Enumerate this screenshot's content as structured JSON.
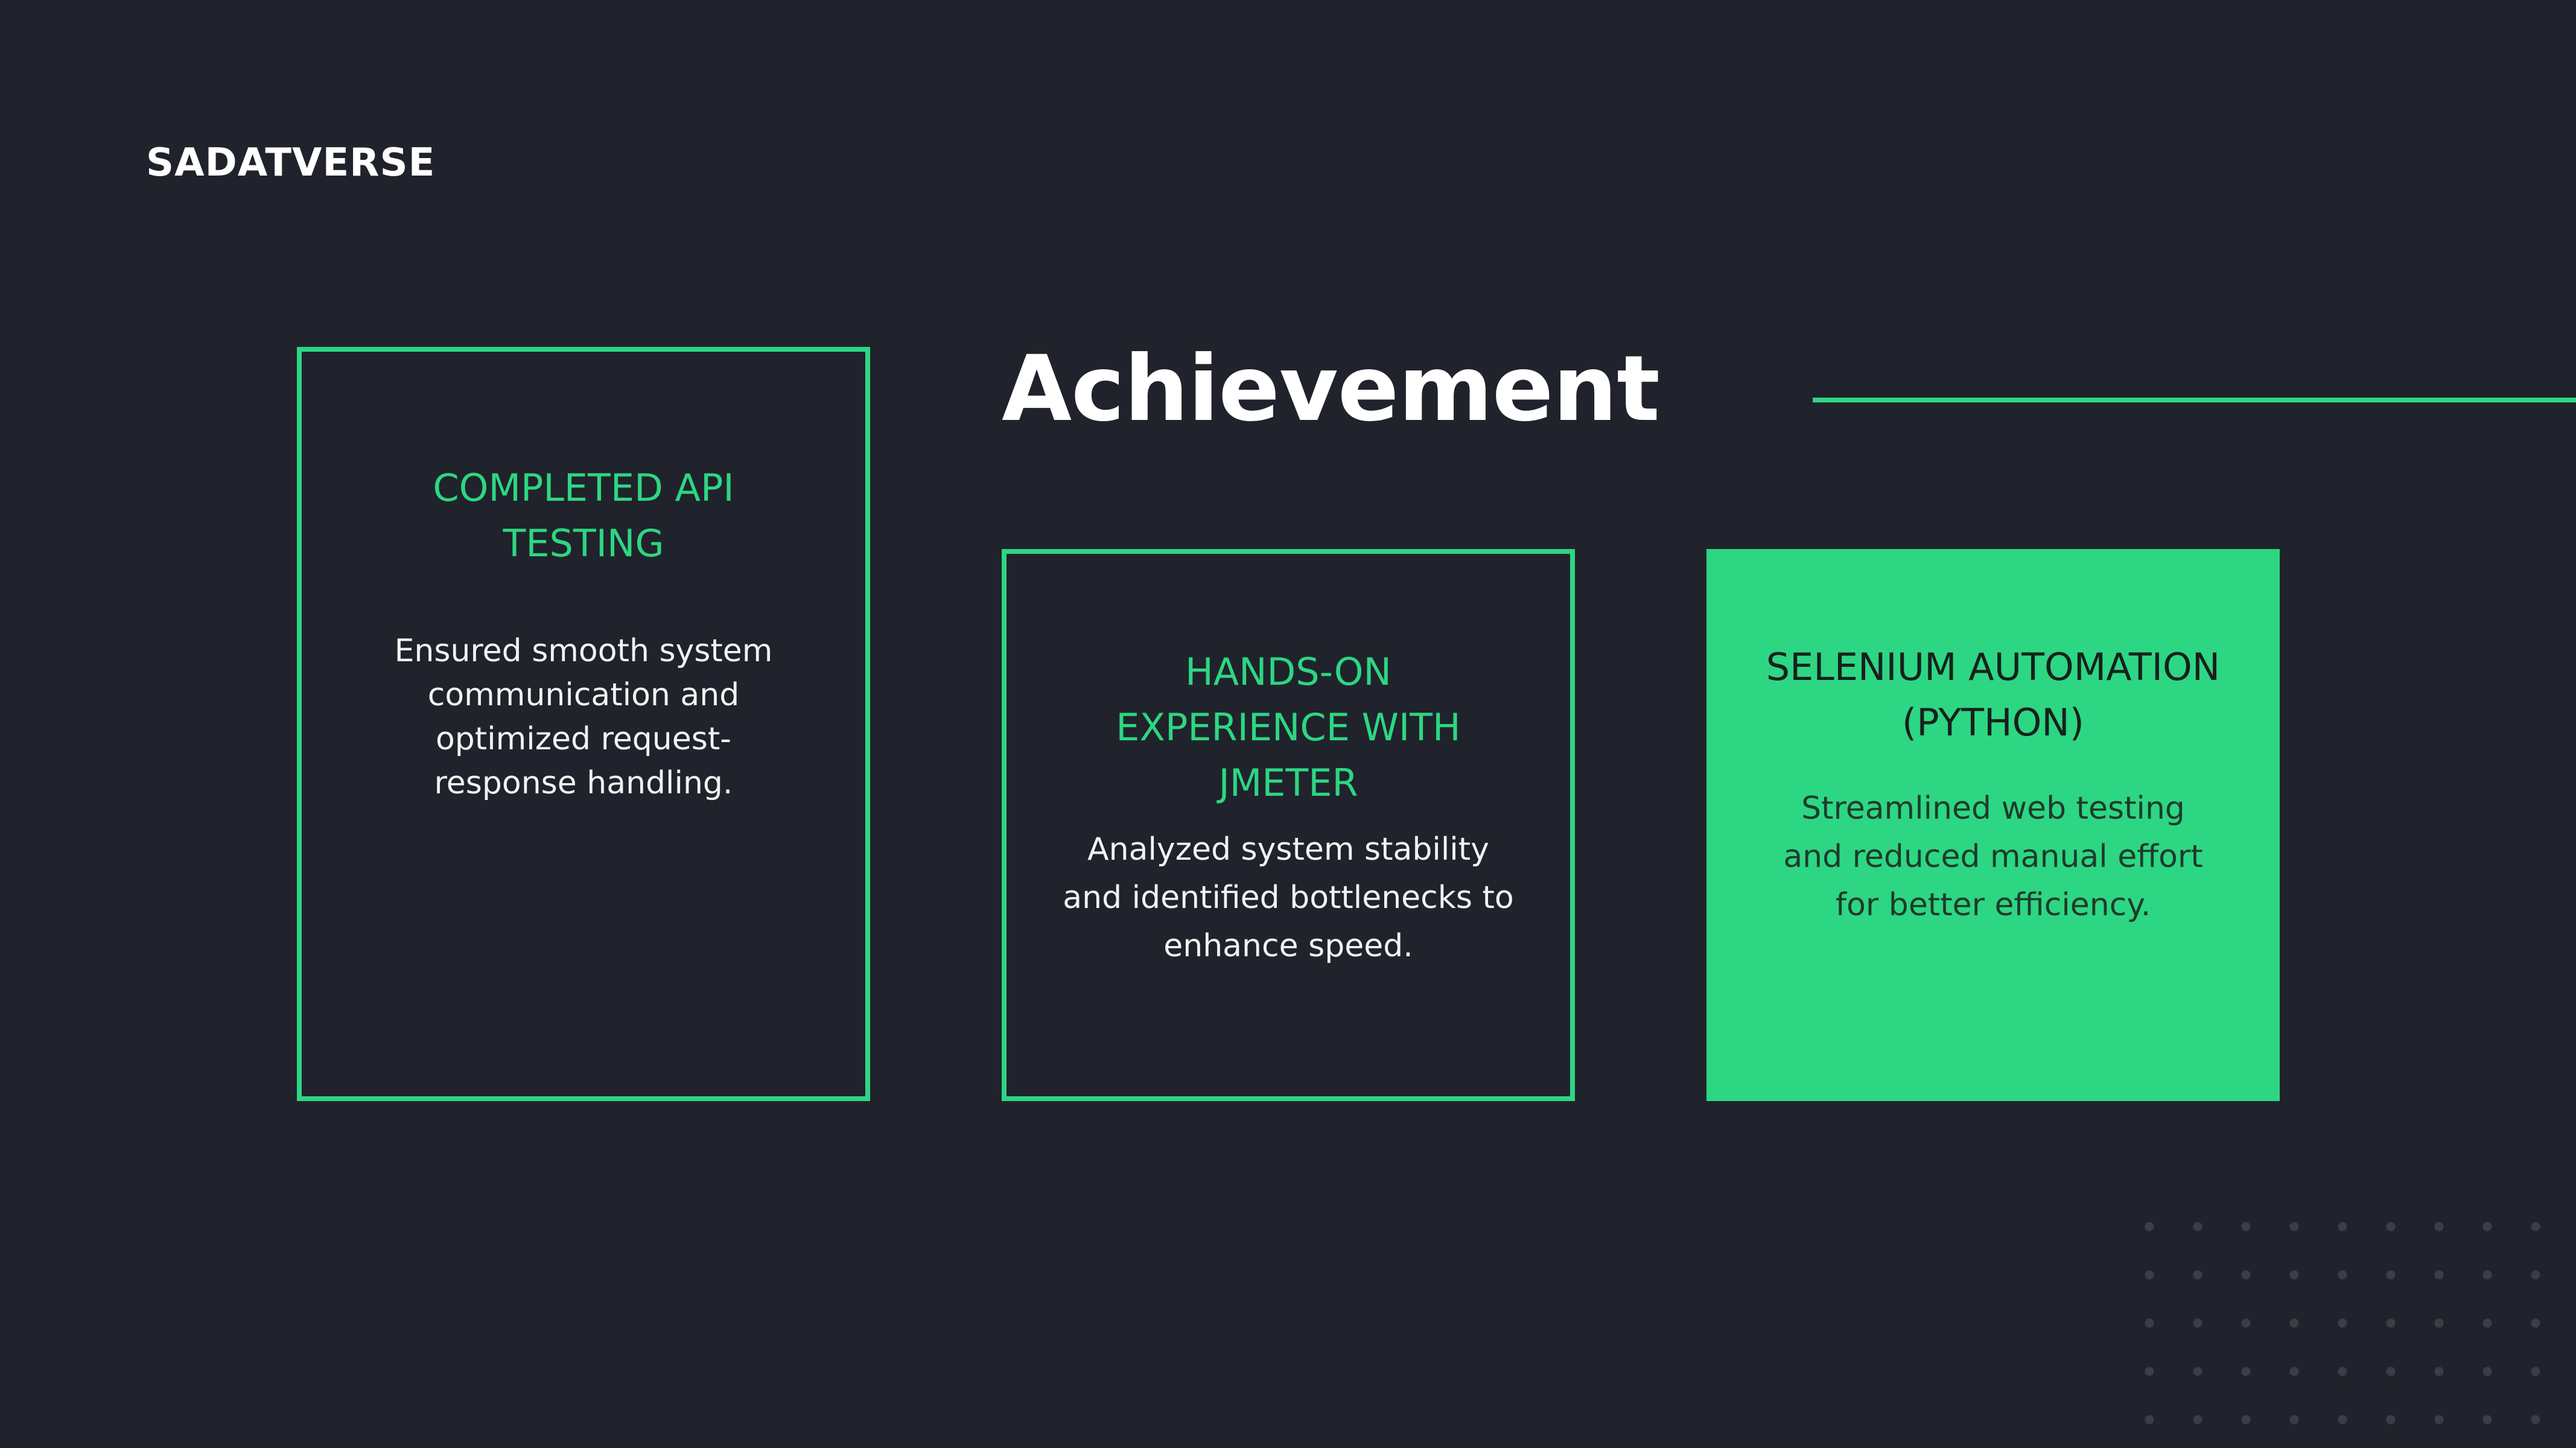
{
  "brand": "SADATVERSE",
  "title": "Achievement",
  "colors": {
    "background": "#20232b",
    "accent": "#2dd683",
    "text": "#ffffff"
  },
  "cards": [
    {
      "heading": "COMPLETED API TESTING",
      "body": "Ensured smooth system communication and optimized request-response handling.",
      "style": "outline"
    },
    {
      "heading": "HANDS-ON EXPERIENCE WITH JMETER",
      "body": "Analyzed system stability and identified bottlenecks to enhance speed.",
      "style": "outline"
    },
    {
      "heading": "SELENIUM AUTOMATION (PYTHON)",
      "body": "Streamlined web testing and reduced manual effort for better efficiency.",
      "style": "filled"
    }
  ]
}
